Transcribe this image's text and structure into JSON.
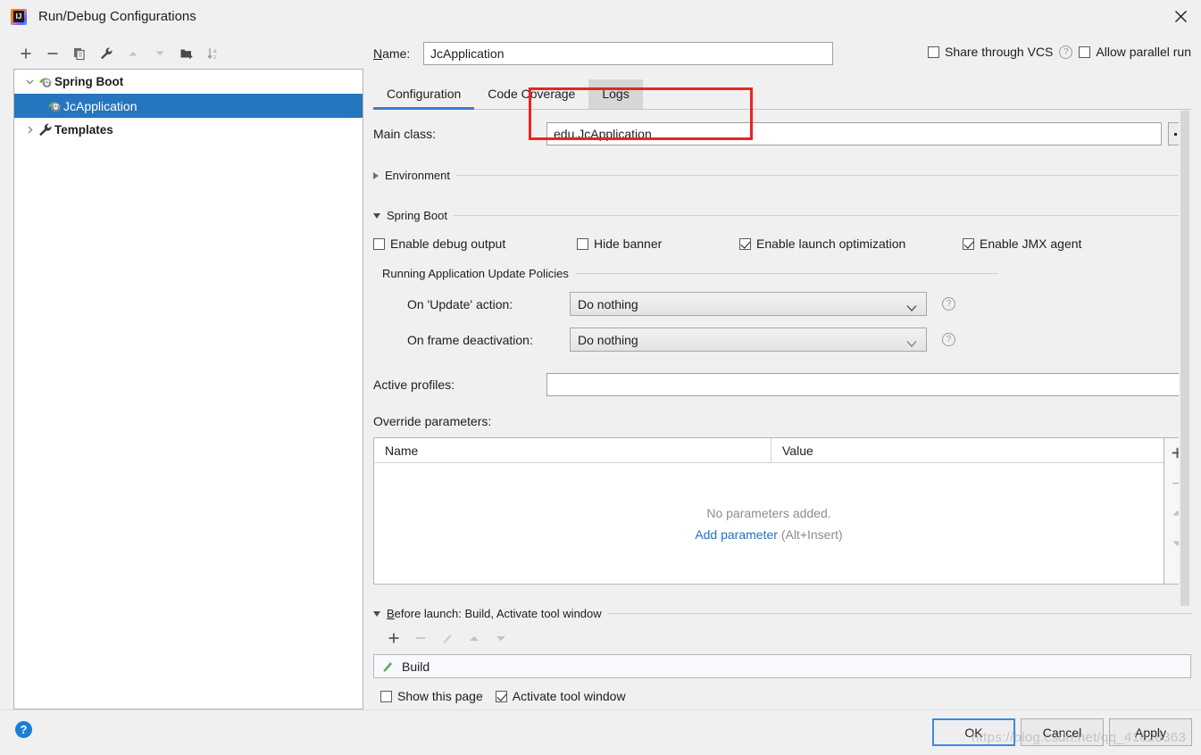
{
  "window": {
    "title": "Run/Debug Configurations",
    "app_icon": "intellij-idea-icon",
    "close_icon": "close-icon"
  },
  "tree_toolbar": {
    "buttons": [
      {
        "name": "add-configuration-button",
        "icon": "plus-icon",
        "enabled": true
      },
      {
        "name": "remove-configuration-button",
        "icon": "minus-icon",
        "enabled": true
      },
      {
        "name": "copy-configuration-button",
        "icon": "copy-icon",
        "enabled": true
      },
      {
        "name": "edit-templates-button",
        "icon": "wrench-icon",
        "enabled": true
      },
      {
        "name": "move-up-button",
        "icon": "arrow-up-icon",
        "enabled": false
      },
      {
        "name": "move-down-button",
        "icon": "arrow-down-icon",
        "enabled": false
      },
      {
        "name": "create-folder-button",
        "icon": "folder-add-icon",
        "enabled": true
      },
      {
        "name": "sort-configurations-button",
        "icon": "sort-az-icon",
        "enabled": true
      }
    ]
  },
  "tree": {
    "nodes": [
      {
        "label": "Spring Boot",
        "icon": "spring-boot-icon",
        "twisty": "chevron-down-icon",
        "selected": false,
        "level": 0
      },
      {
        "label": "JcApplication",
        "icon": "spring-boot-icon",
        "twisty": "",
        "selected": true,
        "level": 1
      },
      {
        "label": "Templates",
        "icon": "wrench-icon",
        "twisty": "chevron-right-icon",
        "selected": false,
        "level": 0
      }
    ]
  },
  "name_row": {
    "label": "Name:",
    "label_mnemonic": "N",
    "label_rest": "ame:",
    "value": "JcApplication",
    "placeholder": "",
    "share_through_vcs": {
      "label": "Share through VCS",
      "checked": false,
      "help_icon": "question-icon"
    },
    "allow_parallel_run": {
      "label": "Allow parallel run",
      "checked": false
    }
  },
  "tabs": [
    {
      "label": "Configuration",
      "active": true,
      "hover": false
    },
    {
      "label": "Code Coverage",
      "active": false,
      "hover": false
    },
    {
      "label": "Logs",
      "active": false,
      "hover": true
    }
  ],
  "configuration": {
    "main_class": {
      "label": "Main class:",
      "value": "edu.JcApplication",
      "placeholder": "",
      "browse_button": "browse-ellipsis-button"
    },
    "environment_section": {
      "title": "Environment",
      "expanded": false,
      "twisty": "triangle-right-icon"
    },
    "spring_boot_section": {
      "title": "Spring Boot",
      "expanded": true,
      "twisty": "triangle-down-icon",
      "checkboxes": [
        {
          "label": "Enable debug output",
          "checked": false
        },
        {
          "label": "Hide banner",
          "checked": false
        },
        {
          "label": "Enable launch optimization",
          "checked": true
        },
        {
          "label": "Enable JMX agent",
          "checked": true
        }
      ],
      "update_policies": {
        "title": "Running Application Update Policies",
        "rows": [
          {
            "label": "On 'Update' action:",
            "value": "Do nothing",
            "help_icon": "question-icon"
          },
          {
            "label": "On frame deactivation:",
            "value": "Do nothing",
            "help_icon": "question-icon"
          }
        ]
      }
    },
    "active_profiles": {
      "label": "Active profiles:",
      "value": "",
      "placeholder": ""
    },
    "override_parameters": {
      "label": "Override parameters:",
      "columns": [
        "Name",
        "Value"
      ],
      "rows": [],
      "empty_text": "No parameters added.",
      "add_link": "Add parameter",
      "add_hint": "(Alt+Insert)",
      "side_buttons": [
        {
          "name": "add-parameter-button",
          "icon": "plus-icon",
          "enabled": true
        },
        {
          "name": "remove-parameter-button",
          "icon": "minus-icon",
          "enabled": false
        },
        {
          "name": "move-parameter-up-button",
          "icon": "triangle-up-icon",
          "enabled": false
        },
        {
          "name": "move-parameter-down-button",
          "icon": "triangle-down-icon",
          "enabled": false
        }
      ]
    }
  },
  "before_launch": {
    "title": "Before launch: Build, Activate tool window",
    "title_mnemonic": "B",
    "title_rest": "efore launch: Build, Activate tool window",
    "expanded": true,
    "twisty": "triangle-down-icon",
    "toolbar": [
      {
        "name": "add-task-button",
        "icon": "plus-icon",
        "enabled": true
      },
      {
        "name": "remove-task-button",
        "icon": "minus-icon",
        "enabled": false
      },
      {
        "name": "edit-task-button",
        "icon": "pencil-icon",
        "enabled": false
      },
      {
        "name": "move-task-up-button",
        "icon": "triangle-up-icon",
        "enabled": false
      },
      {
        "name": "move-task-down-button",
        "icon": "triangle-down-icon",
        "enabled": false
      }
    ],
    "tasks": [
      {
        "label": "Build",
        "icon": "build-hammer-icon"
      }
    ],
    "show_this_page": {
      "label": "Show this page",
      "checked": false
    },
    "activate_tool_window": {
      "label": "Activate tool window",
      "checked": true
    }
  },
  "bottom_bar": {
    "help_icon": "help-question-icon",
    "buttons": [
      {
        "label": "OK",
        "primary": true
      },
      {
        "label": "Cancel",
        "primary": false
      },
      {
        "label": "Apply",
        "primary": false
      }
    ]
  },
  "watermark": "https://blog.csdn.net/qq_41628363",
  "colors": {
    "selection_blue": "#2675bf",
    "tab_underline": "#3b7dd8",
    "link_blue": "#2470c9",
    "annotation_red": "#ee2222",
    "help_blue": "#1a7ed6",
    "build_green": "#5aa75a"
  }
}
